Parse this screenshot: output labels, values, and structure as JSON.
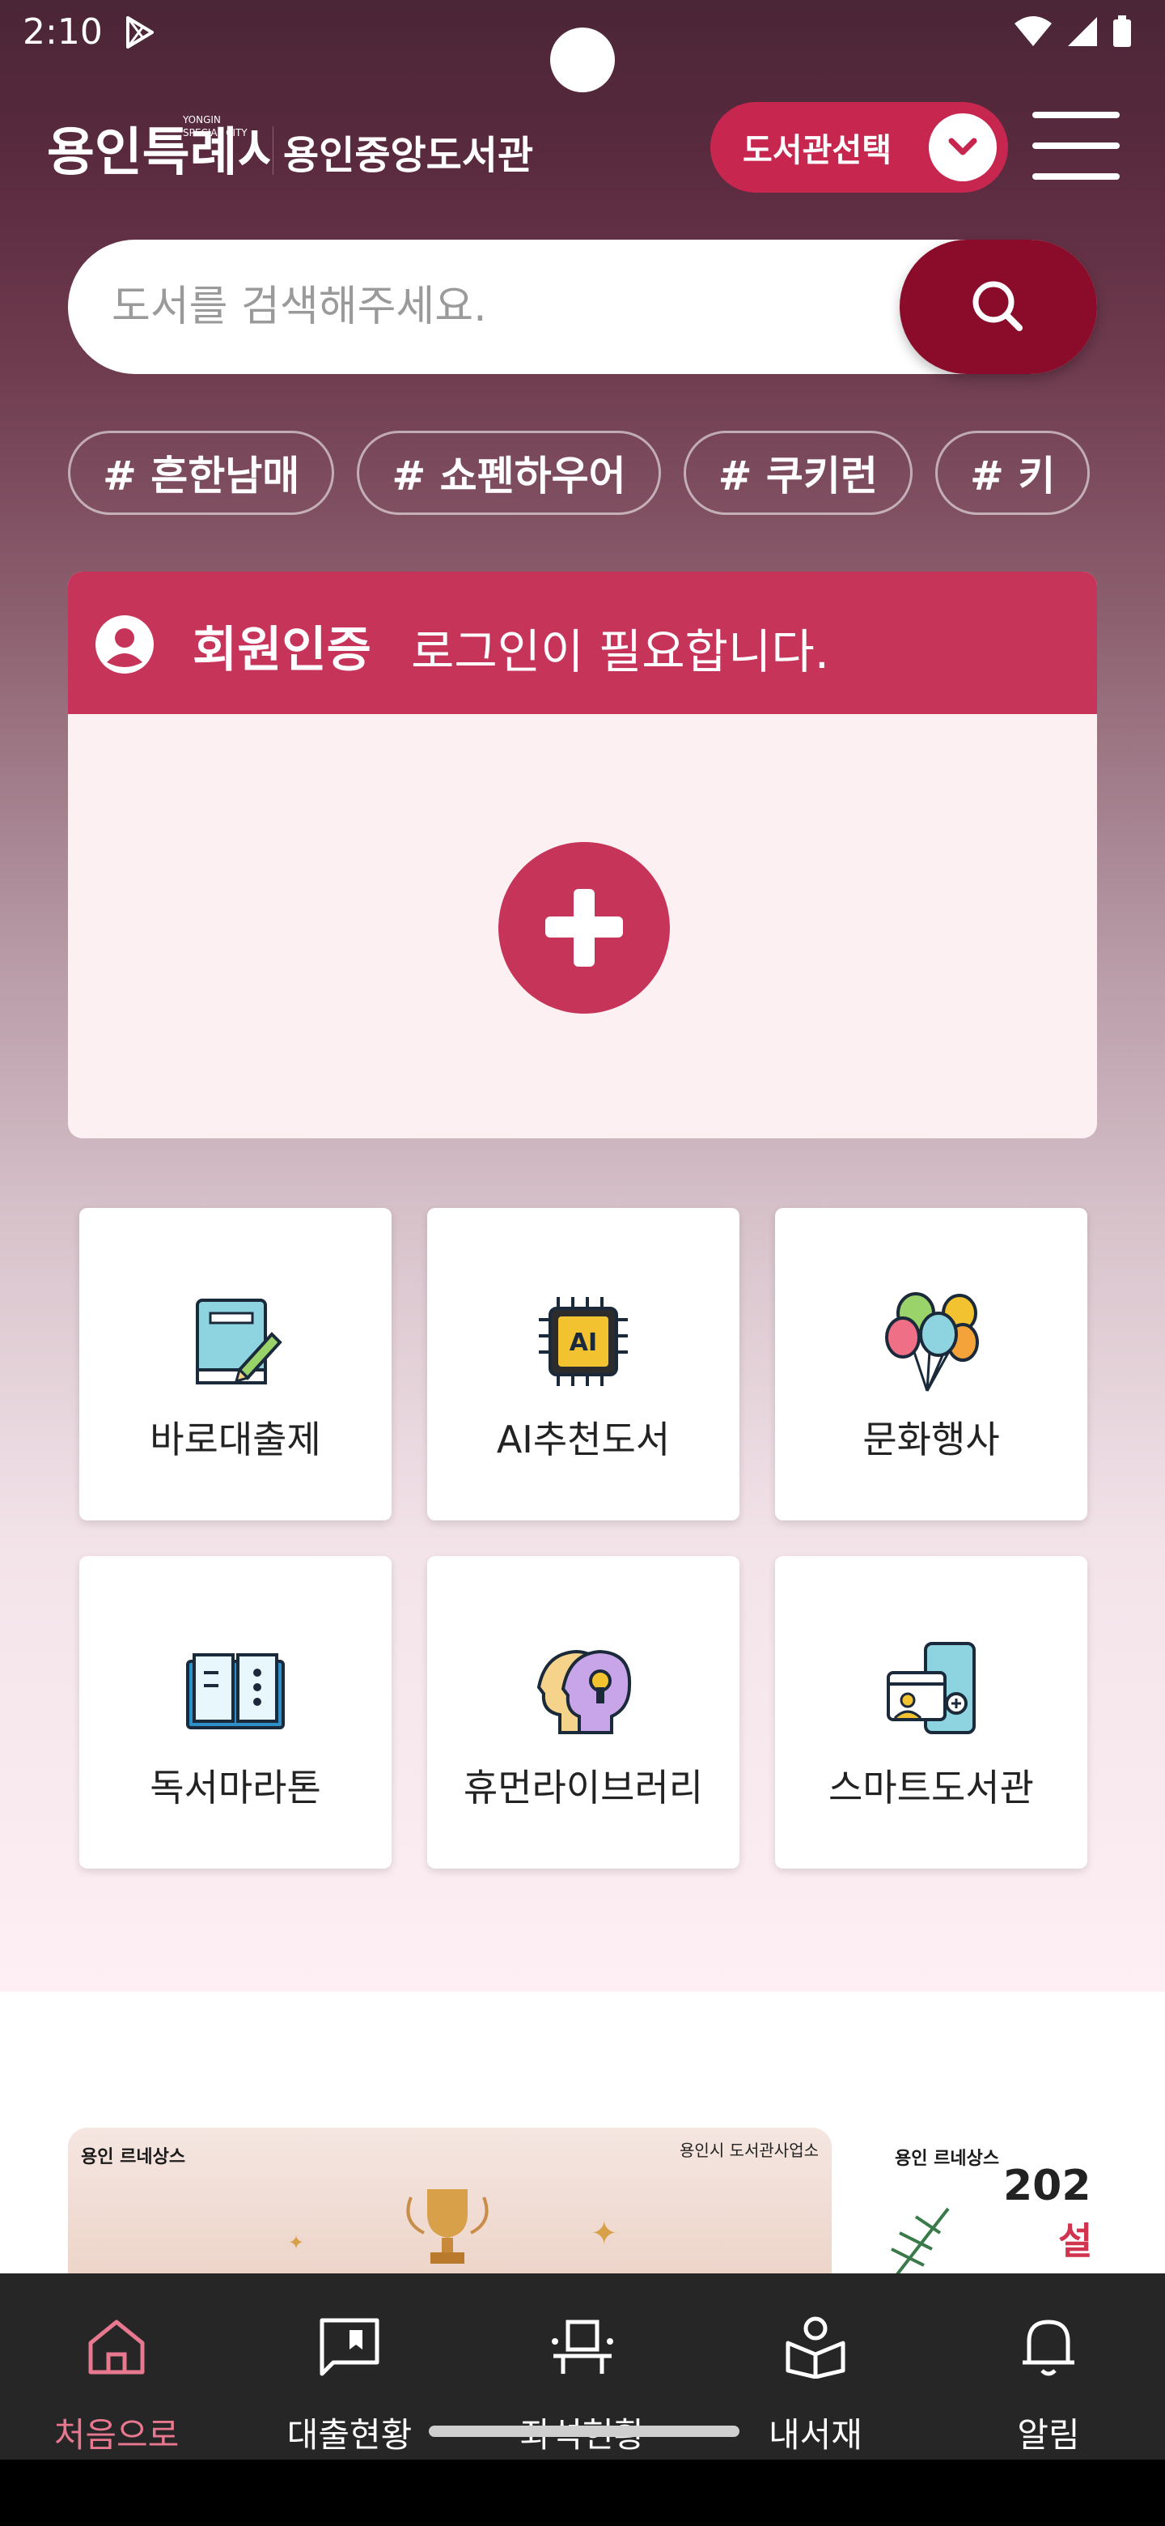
{
  "status_bar": {
    "time": "2:10"
  },
  "header": {
    "logo_text": "용인특례시",
    "logo_sub": "YONGIN SPECIAL CITY",
    "library_name": "용인중앙도서관",
    "library_select_label": "도서관선택"
  },
  "search": {
    "placeholder": "도서를 검색해주세요."
  },
  "tags": [
    "# 흔한남매",
    "# 쇼펜하우어",
    "# 쿠키런",
    "# 키"
  ],
  "member": {
    "title": "회원인증",
    "message": "로그인이 필요합니다."
  },
  "menu": [
    {
      "label": "바로대출제",
      "icon": "book-pencil-icon"
    },
    {
      "label": "AI추천도서",
      "icon": "ai-chip-icon"
    },
    {
      "label": "문화행사",
      "icon": "balloons-icon"
    },
    {
      "label": "독서마라톤",
      "icon": "open-book-icon"
    },
    {
      "label": "휴먼라이브러리",
      "icon": "human-head-icon"
    },
    {
      "label": "스마트도서관",
      "icon": "smartphone-library-icon"
    }
  ],
  "banner": {
    "brand": "용인 르네상스",
    "org": "용인시 도서관사업소",
    "second_brand": "용인 르네상스",
    "second_year": "202",
    "second_sub": "설"
  },
  "bottom_nav": [
    {
      "label": "처음으로",
      "icon": "home-icon",
      "active": true
    },
    {
      "label": "대출현황",
      "icon": "bookmark-chat-icon",
      "active": false
    },
    {
      "label": "좌석현황",
      "icon": "seat-icon",
      "active": false
    },
    {
      "label": "내서재",
      "icon": "my-library-icon",
      "active": false
    },
    {
      "label": "알림",
      "icon": "bell-icon",
      "active": false
    }
  ],
  "colors": {
    "accent": "#c7345a",
    "search_button": "#8a0c2a",
    "nav_bg": "#262626",
    "nav_active": "#e8788f"
  }
}
